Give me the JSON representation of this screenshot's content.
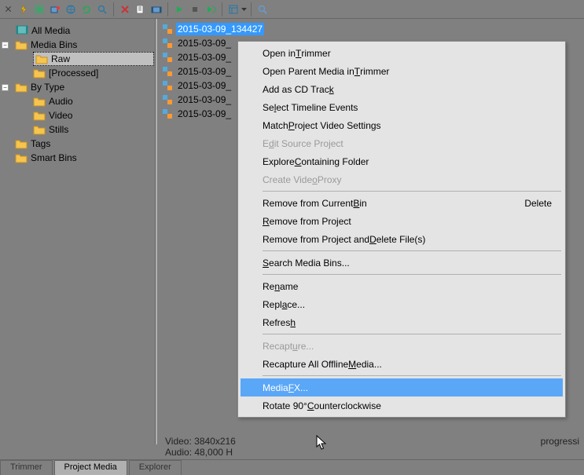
{
  "tree": {
    "all_media": "All Media",
    "media_bins": "Media Bins",
    "raw": "Raw",
    "processed": "[Processed]",
    "by_type": "By Type",
    "audio": "Audio",
    "video": "Video",
    "stills": "Stills",
    "tags": "Tags",
    "smart_bins": "Smart Bins"
  },
  "list": {
    "items": [
      {
        "name": "2015-03-09_134427"
      },
      {
        "name": "2015-03-09_"
      },
      {
        "name": "2015-03-09_"
      },
      {
        "name": "2015-03-09_"
      },
      {
        "name": "2015-03-09_"
      },
      {
        "name": "2015-03-09_"
      },
      {
        "name": "2015-03-09_"
      }
    ]
  },
  "status": {
    "video": "Video: 3840x216",
    "audio": "Audio: 48,000 H",
    "extra": "progressi"
  },
  "tabs": {
    "trimmer": "Trimmer",
    "project_media": "Project Media",
    "explorer": "Explorer"
  },
  "ctx": {
    "open_trimmer_a": "Open in ",
    "open_trimmer_u": "T",
    "open_trimmer_b": "rimmer",
    "open_parent_a": "Open Parent Media in ",
    "open_parent_u": "T",
    "open_parent_b": "rimmer",
    "add_cd_a": "Add as CD Trac",
    "add_cd_u": "k",
    "select_tl_a": "Se",
    "select_tl_u": "l",
    "select_tl_b": "ect Timeline Events",
    "match_a": "Match ",
    "match_u": "P",
    "match_b": "roject Video Settings",
    "edit_src_a": "E",
    "edit_src_u": "d",
    "edit_src_b": "it Source Project",
    "explore_a": "Explore ",
    "explore_u": "C",
    "explore_b": "ontaining Folder",
    "proxy_a": "Create Vide",
    "proxy_u": "o",
    "proxy_b": " Proxy",
    "rm_bin_a": "Remove from Current ",
    "rm_bin_u": "B",
    "rm_bin_b": "in",
    "rm_bin_shortcut": "Delete",
    "rm_proj_a": "",
    "rm_proj_u": "R",
    "rm_proj_b": "emove from Project",
    "rm_del_a": "Remove from Project and ",
    "rm_del_u": "D",
    "rm_del_b": "elete File(s)",
    "search_a": "",
    "search_u": "S",
    "search_b": "earch Media Bins...",
    "rename_a": "Re",
    "rename_u": "n",
    "rename_b": "ame",
    "replace_a": "Repl",
    "replace_u": "a",
    "replace_b": "ce...",
    "refresh_a": "Refres",
    "refresh_u": "h",
    "recap_a": "Recapt",
    "recap_u": "u",
    "recap_b": "re...",
    "recap_all_a": "Recapture All Offline ",
    "recap_all_u": "M",
    "recap_all_b": "edia...",
    "fx_a": "Media ",
    "fx_u": "F",
    "fx_b": "X...",
    "rotate_a": "Rotate 90° ",
    "rotate_u": "C",
    "rotate_b": "ounterclockwise"
  }
}
